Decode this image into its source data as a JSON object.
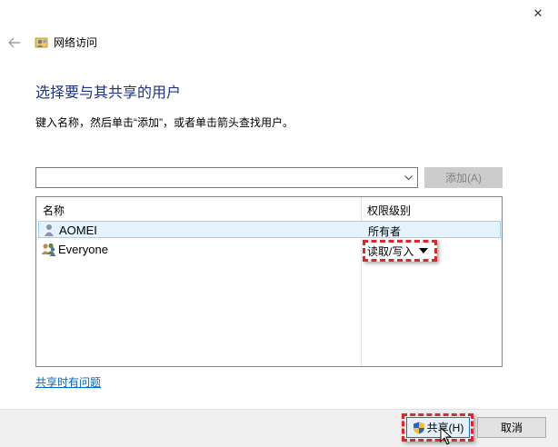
{
  "window": {
    "close_glyph": "✕",
    "title": "网络访问"
  },
  "main": {
    "heading": "选择要与其共享的用户",
    "instruction": "键入名称，然后单击“添加”，或者单击箭头查找用户。",
    "combo_value": "",
    "add_button": "添加(A)"
  },
  "list": {
    "columns": {
      "name": "名称",
      "permission": "权限级别"
    },
    "rows": [
      {
        "name": "AOMEI",
        "permission": "所有者",
        "icon": "user-icon",
        "selected": true
      },
      {
        "name": "Everyone",
        "permission": "读取/写入",
        "icon": "group-icon",
        "selected": false
      }
    ]
  },
  "links": {
    "help": "共享时有问题"
  },
  "footer": {
    "share_button": "共享(H)",
    "cancel_button": "取消"
  },
  "colors": {
    "heading": "#1e3287",
    "link": "#0066cc",
    "highlight": "#e0262b",
    "selection": "#e5f3ff",
    "primary_border": "#0078d7"
  }
}
